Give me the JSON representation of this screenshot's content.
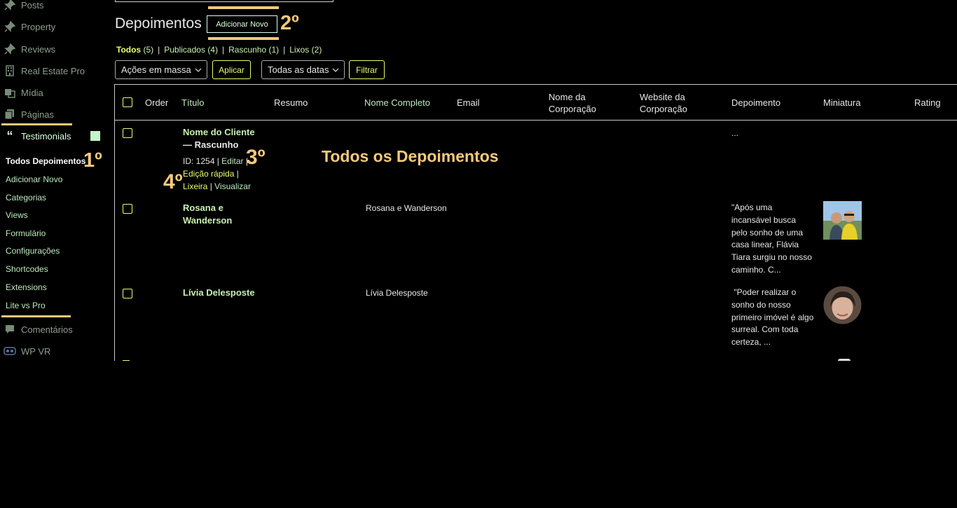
{
  "sidebar": {
    "menu": [
      {
        "label": "Posts",
        "icon": "pin-icon"
      },
      {
        "label": "Property",
        "icon": "pin-icon"
      },
      {
        "label": "Reviews",
        "icon": "pin-icon"
      },
      {
        "label": "Real Estate Pro",
        "icon": "building-icon"
      },
      {
        "label": "Mídia",
        "icon": "media-icon"
      },
      {
        "label": "Páginas",
        "icon": "pages-icon"
      },
      {
        "label": "Testimonials",
        "icon": "quote-icon"
      }
    ],
    "submenu": [
      "Todos Depoimentos",
      "Adicionar Novo",
      "Categorias",
      "Views",
      "Formulário",
      "Configurações",
      "Shortcodes",
      "Extensions",
      "Lite vs Pro"
    ],
    "menu_after": [
      {
        "label": "Comentários",
        "icon": "comment-icon"
      },
      {
        "label": "WP VR",
        "icon": "vr-icon"
      }
    ]
  },
  "header": {
    "title": "Depoimentos",
    "add_new": "Adicionar Novo"
  },
  "filters": [
    {
      "label": "Todos",
      "count": "(5)"
    },
    {
      "label": "Publicados",
      "count": "(4)"
    },
    {
      "label": "Rascunho",
      "count": "(1)"
    },
    {
      "label": "Lixos",
      "count": "(2)"
    }
  ],
  "actions": {
    "bulk": "Ações em massa",
    "apply": "Aplicar",
    "dates": "Todas as datas",
    "filter": "Filtrar"
  },
  "table": {
    "columns": [
      "Order",
      "Título",
      "Resumo",
      "Nome Completo",
      "Email",
      "Nome da Corporação",
      "Website da Corporação",
      "Depoimento",
      "Miniatura",
      "Rating"
    ],
    "rows": [
      {
        "title": "Nome do Cliente",
        "status": "— Rascunho",
        "id": "ID: 1254",
        "edit": "Editar",
        "quick_edit": "Edição rápida",
        "trash": "Lixeira",
        "view": "Visualizar",
        "name": "",
        "testimonial": "..."
      },
      {
        "title": "Rosana e Wanderson",
        "name": "Rosana e Wanderson",
        "testimonial": "\"Após uma incansável busca pelo sonho de uma casa linear, Flávia Tiara surgiu no nosso caminho. C..."
      },
      {
        "title": "Lívia Delesposte",
        "name": "Lívia Delesposte",
        "testimonial": " \"Poder realizar o sonho do nosso primeiro imóvel é algo surreal. Com toda certeza, ..."
      }
    ]
  },
  "annotations": {
    "step1": "1º",
    "step2": "2º",
    "step3": "3º",
    "step4": "4º",
    "overlay": "Todos os Depoimentos"
  },
  "colors": {
    "accent": "#f5c97a",
    "button_yellow": "#e6ff6b",
    "link_green": "#c9f0b0"
  }
}
